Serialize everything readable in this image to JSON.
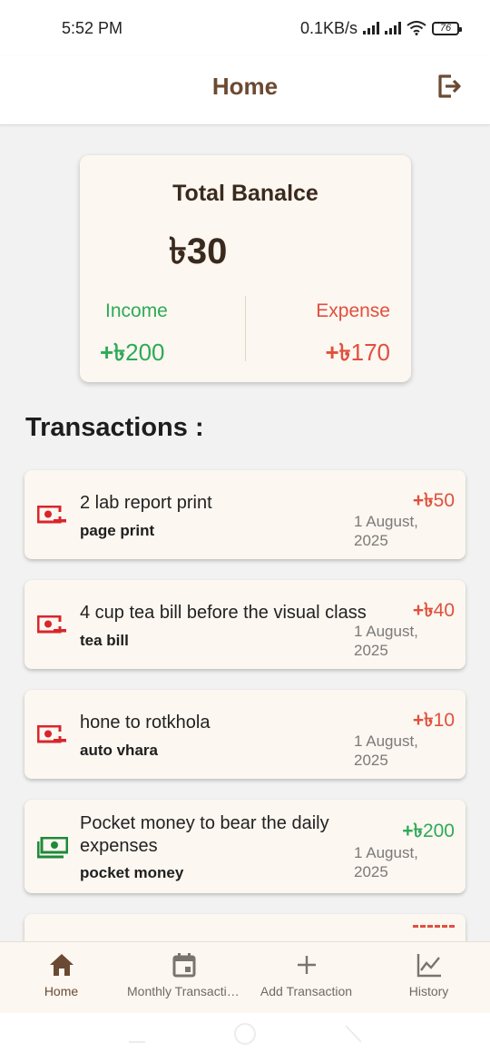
{
  "status_bar": {
    "time": "5:52 PM",
    "network_speed": "0.1KB/s",
    "battery": "76"
  },
  "app_bar": {
    "title": "Home",
    "logout_icon": "logout-icon"
  },
  "balance": {
    "label": "Total Banalce",
    "value": "৳30",
    "income_label": "Income",
    "income_sign": "+৳",
    "income_amount": "200",
    "expense_label": "Expense",
    "expense_sign": "+৳",
    "expense_amount": "170"
  },
  "transactions_title": "Transactions :",
  "transactions": [
    {
      "title": "2 lab report print",
      "category": "page print",
      "amount_sign": "+৳",
      "amount": "50",
      "type": "expense",
      "date": "1 August, 2025",
      "icon": "money-out-icon"
    },
    {
      "title": "4 cup tea bill before the visual class",
      "category": "tea bill",
      "amount_sign": "+৳",
      "amount": "40",
      "type": "expense",
      "date": "1 August, 2025",
      "icon": "money-out-icon"
    },
    {
      "title": "hone to rotkhola",
      "category": "auto vhara",
      "amount_sign": "+৳",
      "amount": "10",
      "type": "expense",
      "date": "1 August, 2025",
      "icon": "money-out-icon"
    },
    {
      "title": "Pocket money to bear the daily expenses",
      "category": "pocket money",
      "amount_sign": "+৳",
      "amount": "200",
      "type": "income",
      "date": "1 August, 2025",
      "icon": "money-in-icon"
    }
  ],
  "colors": {
    "brand": "#6b4a33",
    "income": "#2eaa58",
    "expense": "#e0503e",
    "card": "#fcf7f0"
  },
  "bottom_nav": [
    {
      "label": "Home",
      "icon": "home-icon",
      "active": true
    },
    {
      "label": "Monthly Transactions",
      "icon": "calendar-icon",
      "active": false
    },
    {
      "label": "Add Transaction",
      "icon": "plus-icon",
      "active": false
    },
    {
      "label": "History",
      "icon": "chart-line-icon",
      "active": false
    }
  ]
}
